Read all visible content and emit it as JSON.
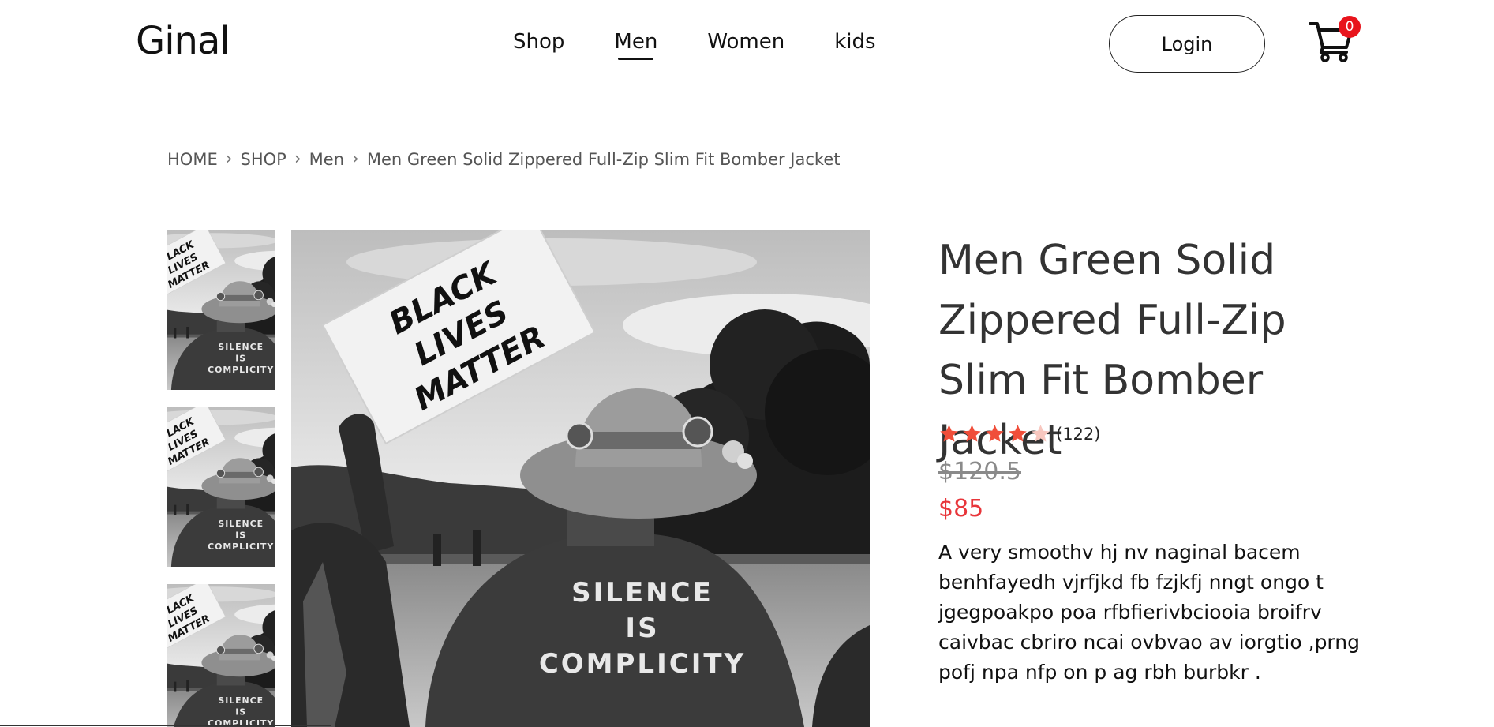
{
  "brand": {
    "logo": "Ginal"
  },
  "nav": {
    "links": [
      {
        "label": "Shop"
      },
      {
        "label": "Men"
      },
      {
        "label": "Women"
      },
      {
        "label": "kids"
      }
    ],
    "active": "Men",
    "login_label": "Login",
    "cart_count": "0"
  },
  "breadcrumb": {
    "items": [
      "HOME",
      "SHOP",
      "Men"
    ],
    "current": "Men Green Solid Zippered Full-Zip Slim Fit Bomber Jacket"
  },
  "product": {
    "title": "Men Green Solid Zippered Full-Zip Slim Fit Bomber Jacket",
    "rating": 4,
    "rating_max": 5,
    "review_count": "(122)",
    "old_price": "$120.5",
    "price": "$85",
    "description": "A very smoothv hj nv naginal bacem benhfayedh vjrfjkd fb fzjkfj nngt ongo t jgegpoakpo poa rfbfierivbciooia broifrv caivbac cbriro ncai ovbvao av iorgtio ,prng pofj npa nfp on p ag rbh burbkr ."
  },
  "images": {
    "sign_text": "BLACK LIVES MATTER",
    "shirt_text": [
      "SILENCE",
      "IS",
      "COMPLICITY"
    ]
  },
  "colors": {
    "accent_red": "#e8353a",
    "badge_red": "#e8141c",
    "star": "#f04e3a",
    "star_empty": "#f8c7bf"
  },
  "icons": {
    "cart": "cart-icon",
    "breadcrumb_separator": "chevron-right-icon",
    "star": "star-icon"
  }
}
